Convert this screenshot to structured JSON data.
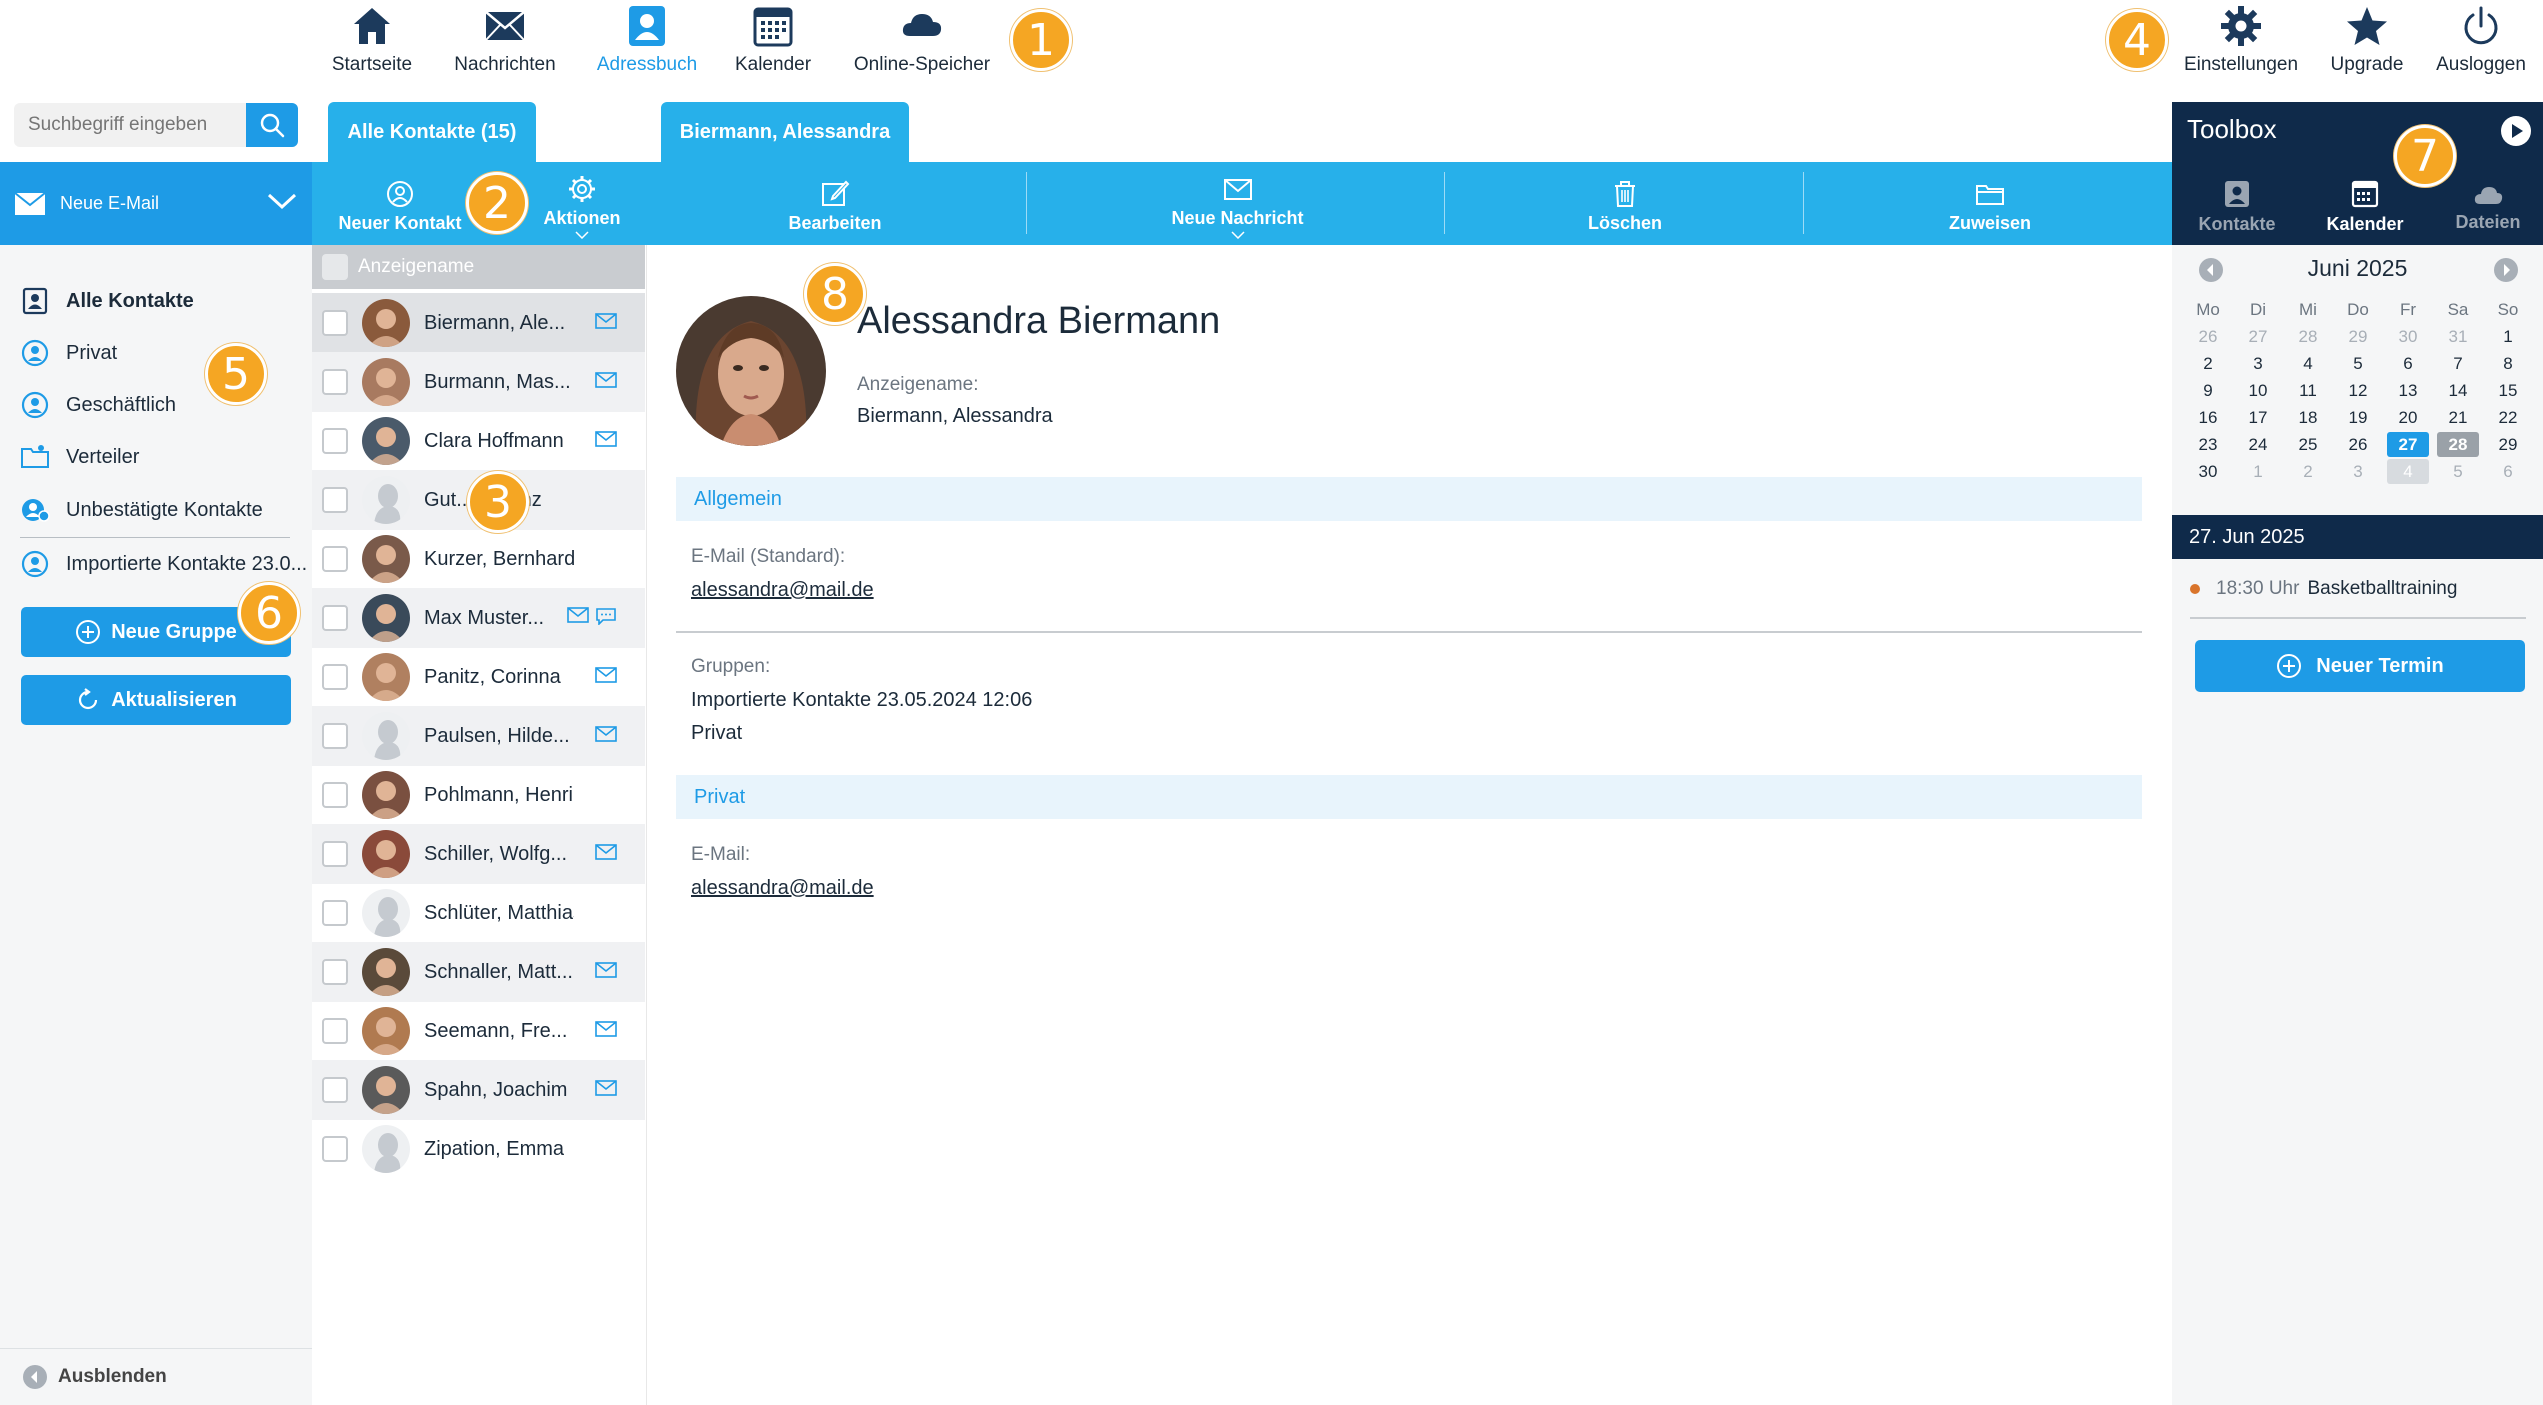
{
  "nav": {
    "items": [
      {
        "label": "Startseite",
        "icon": "home-icon"
      },
      {
        "label": "Nachrichten",
        "icon": "mail-icon"
      },
      {
        "label": "Adressbuch",
        "icon": "addressbook-icon",
        "active": true
      },
      {
        "label": "Kalender",
        "icon": "calendar-icon"
      },
      {
        "label": "Online-Speicher",
        "icon": "cloud-icon"
      }
    ],
    "right": [
      {
        "label": "Einstellungen",
        "icon": "gear-icon"
      },
      {
        "label": "Upgrade",
        "icon": "star-icon"
      },
      {
        "label": "Ausloggen",
        "icon": "power-icon"
      }
    ]
  },
  "badges": [
    "1",
    "2",
    "3",
    "4",
    "5",
    "6",
    "7",
    "8"
  ],
  "search": {
    "placeholder": "Suchbegriff eingeben"
  },
  "tabs": {
    "all": "Alle Kontakte (15)",
    "contact": "Biermann, Alessandra"
  },
  "toolbar": {
    "new_mail": "Neue E-Mail",
    "new_contact": "Neuer Kontakt",
    "actions": "Aktionen",
    "edit": "Bearbeiten",
    "new_message": "Neue Nachricht",
    "delete": "Löschen",
    "assign": "Zuweisen"
  },
  "folders": [
    {
      "label": "Alle Kontakte",
      "active": true
    },
    {
      "label": "Privat"
    },
    {
      "label": "Geschäftlich"
    },
    {
      "label": "Verteiler"
    },
    {
      "label": "Unbestätigte Kontakte"
    },
    {
      "label": "Importierte Kontakte 23.0..."
    }
  ],
  "sidebar_buttons": {
    "new_group": "Neue Gruppe",
    "refresh": "Aktualisieren",
    "hide": "Ausblenden"
  },
  "list": {
    "header": "Anzeigename",
    "contacts": [
      {
        "name": "Biermann, Ale...",
        "mail": true
      },
      {
        "name": "Burmann, Mas...",
        "mail": true
      },
      {
        "name": "Clara Hoffmann",
        "mail": true
      },
      {
        "name": "Gut...-l-Heinz",
        "mail": false
      },
      {
        "name": "Kurzer, Bernhard",
        "mail": false
      },
      {
        "name": "Max Muster...",
        "mail": true,
        "chat": true
      },
      {
        "name": "Panitz, Corinna",
        "mail": true
      },
      {
        "name": "Paulsen, Hilde...",
        "mail": true
      },
      {
        "name": "Pohlmann, Henrik",
        "mail": false
      },
      {
        "name": "Schiller, Wolfg...",
        "mail": true
      },
      {
        "name": "Schlüter, Matthias",
        "mail": false
      },
      {
        "name": "Schnaller, Matt...",
        "mail": true
      },
      {
        "name": "Seemann, Fre...",
        "mail": true
      },
      {
        "name": "Spahn, Joachim",
        "mail": true
      },
      {
        "name": "Zipation, Emma",
        "mail": false
      }
    ]
  },
  "detail": {
    "full_name": "Alessandra Biermann",
    "display_label": "Anzeigename:",
    "display_value": "Biermann, Alessandra",
    "section_general": "Allgemein",
    "email_std_label": "E-Mail (Standard):",
    "email_std_value": "alessandra@mail.de",
    "groups_label": "Gruppen:",
    "group_1": "Importierte Kontakte 23.05.2024 12:06",
    "group_2": "Privat",
    "section_private": "Privat",
    "email_label": "E-Mail:",
    "email_value": "alessandra@mail.de"
  },
  "toolbox": {
    "title": "Toolbox",
    "tabs": [
      "Kontakte",
      "Kalender",
      "Dateien"
    ],
    "month": "Juni 2025",
    "weekdays": [
      "Mo",
      "Di",
      "Mi",
      "Do",
      "Fr",
      "Sa",
      "So"
    ],
    "weeks": [
      [
        "26",
        "27",
        "28",
        "29",
        "30",
        "31",
        "1"
      ],
      [
        "2",
        "3",
        "4",
        "5",
        "6",
        "7",
        "8"
      ],
      [
        "9",
        "10",
        "11",
        "12",
        "13",
        "14",
        "15"
      ],
      [
        "16",
        "17",
        "18",
        "19",
        "20",
        "21",
        "22"
      ],
      [
        "23",
        "24",
        "25",
        "26",
        "27",
        "28",
        "29"
      ],
      [
        "30",
        "1",
        "2",
        "3",
        "4",
        "5",
        "6"
      ]
    ],
    "selected_date": "27. Jun 2025",
    "event_time": "18:30 Uhr",
    "event_title": "Basketballtraining",
    "new_event": "Neuer Termin"
  },
  "colors": {
    "accent": "#1e9be6",
    "toolbar": "#27b0ea",
    "navy": "#0f2a4a",
    "badge": "#f5a623"
  }
}
